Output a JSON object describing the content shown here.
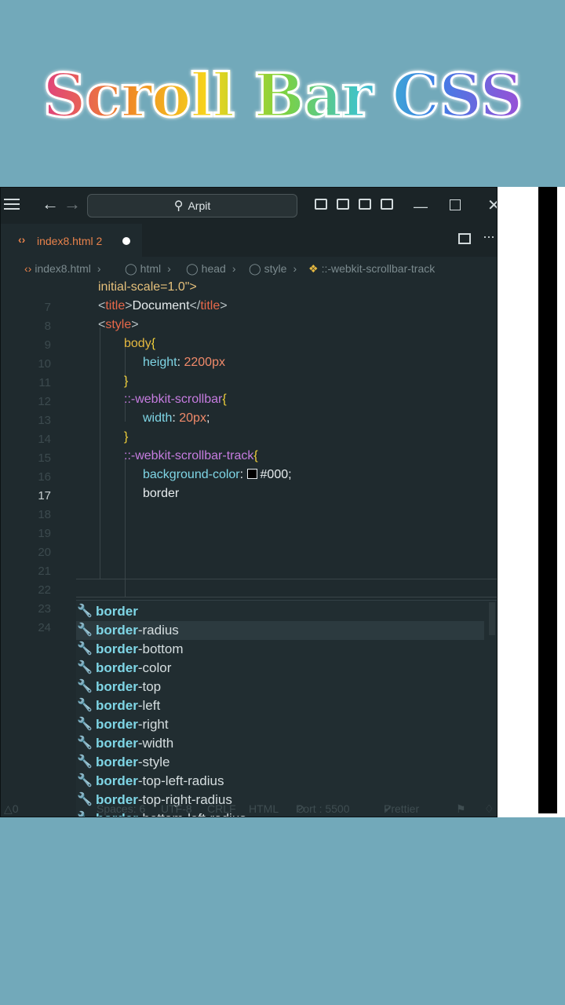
{
  "hero": {
    "title": "Scroll Bar CSS"
  },
  "titlebar": {
    "search": "Arpit"
  },
  "tab": {
    "filename": "index8.html",
    "count": "2"
  },
  "breadcrumb": {
    "file": "index8.html",
    "items": [
      "html",
      "head",
      "style",
      "::-webkit-scrollbar-track"
    ]
  },
  "code": {
    "line_numbers": [
      "7",
      "8",
      "9",
      "10",
      "11",
      "12",
      "13",
      "14",
      "15",
      "16",
      "17",
      "18",
      "19",
      "20",
      "21",
      "22",
      "23",
      "24"
    ],
    "active_line": "17",
    "l0": "initial-scale=1.0\">",
    "l7_open": "<",
    "l7_tag": "title",
    "l7_close": ">",
    "l7_text": "Document",
    "l7_end_open": "</",
    "l7_end_tag": "title",
    "l7_end_close": ">",
    "l8_open": "<",
    "l8_tag": "style",
    "l8_close": ">",
    "l9_sel": "body",
    "l9_brace": "{",
    "l10_prop": "height",
    "l10_colon": ": ",
    "l10_val": "2200px",
    "l11_brace": "}",
    "l12_sel": "::-webkit-scrollbar",
    "l12_brace": "{",
    "l13_prop": "width",
    "l13_colon": ": ",
    "l13_val": "20px",
    "l13_semi": ";",
    "l14_brace": "}",
    "l15_sel": "::-webkit-scrollbar-track",
    "l15_brace": "{",
    "l16_prop": "background-color",
    "l16_colon": ": ",
    "l16_val": "#000",
    "l16_semi": ";",
    "l17_text": "border"
  },
  "suggestions": {
    "match": "border",
    "items": [
      {
        "match": "border",
        "rest": ""
      },
      {
        "match": "border",
        "rest": "-radius"
      },
      {
        "match": "border",
        "rest": "-bottom"
      },
      {
        "match": "border",
        "rest": "-color"
      },
      {
        "match": "border",
        "rest": "-top"
      },
      {
        "match": "border",
        "rest": "-left"
      },
      {
        "match": "border",
        "rest": "-right"
      },
      {
        "match": "border",
        "rest": "-width"
      },
      {
        "match": "border",
        "rest": "-style"
      },
      {
        "match": "border",
        "rest": "-top-left-radius"
      },
      {
        "match": "border",
        "rest": "-top-right-radius"
      },
      {
        "match": "border",
        "rest": "-bottom-left-radius"
      }
    ],
    "highlighted_index": 1
  },
  "status": {
    "problems": "0",
    "spaces": "Spaces: 6",
    "encoding": "UTF-8",
    "eol": "CRLF",
    "language": "HTML",
    "port": "Port : 5500",
    "formatter": "Prettier"
  },
  "icons": {
    "menu": "hamburger-icon",
    "back": "arrow-left-icon",
    "forward": "arrow-right-icon",
    "search": "search-icon",
    "file": "code-file-icon",
    "dot": "unsaved-dot-icon",
    "wrench": "wrench-icon"
  }
}
